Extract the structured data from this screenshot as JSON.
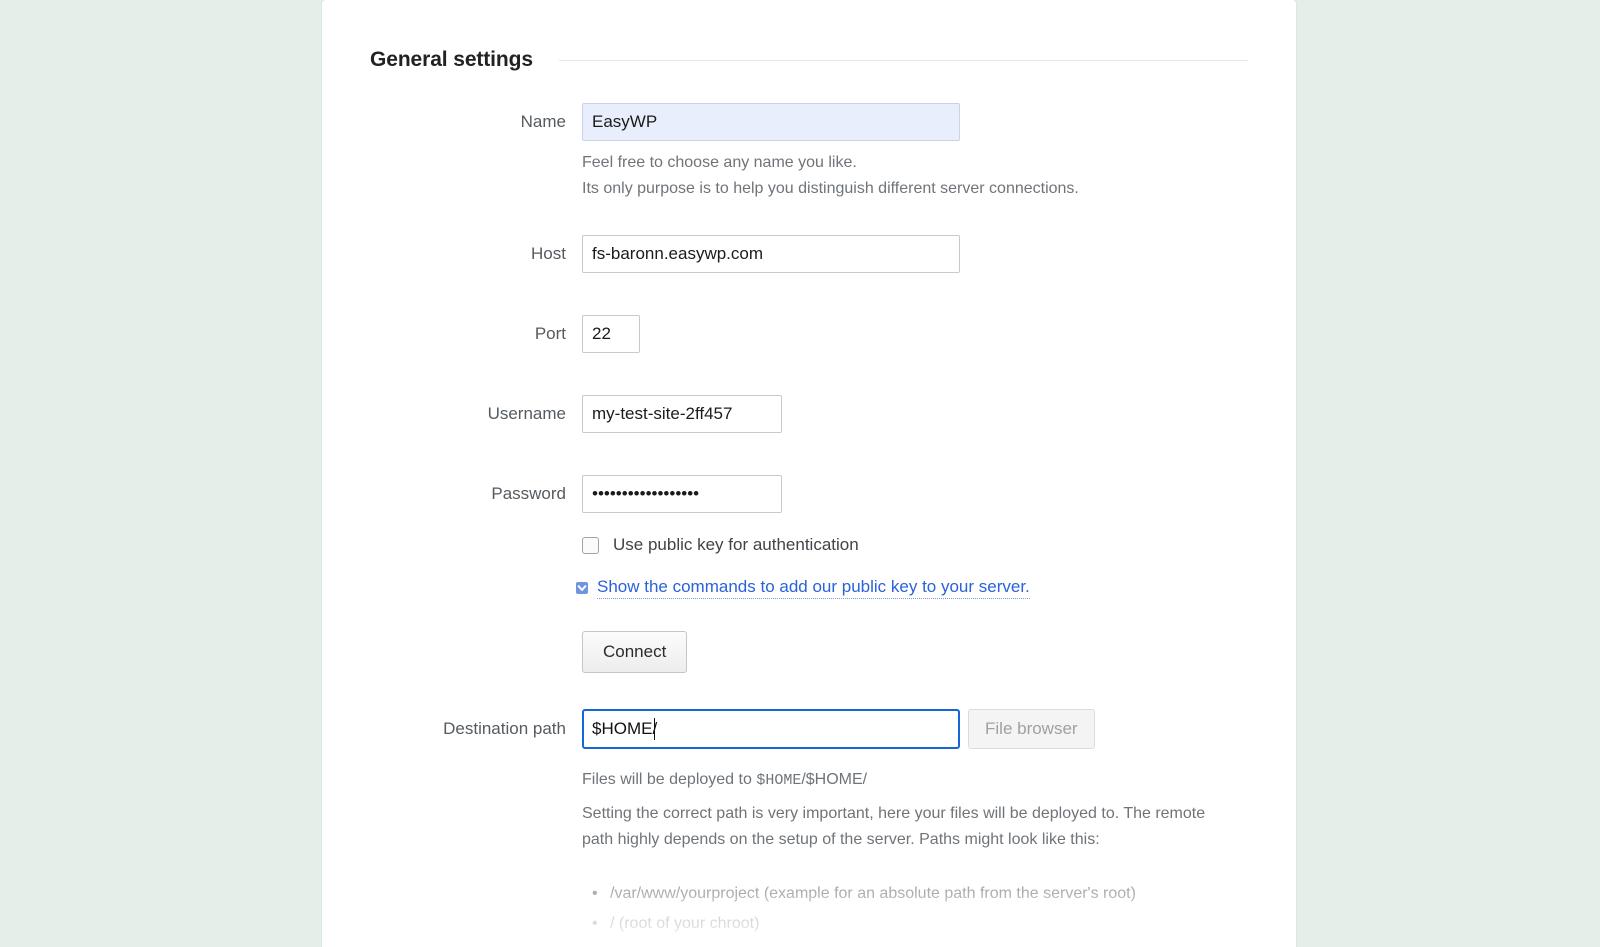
{
  "theme": {
    "page_background": "#e5efe9",
    "card_background": "#ffffff",
    "link_color": "#2a62d8",
    "focus_border": "#1566d6",
    "autofill_background": "#e8eefb",
    "label_color": "#555b60",
    "helper_color": "#6f7479"
  },
  "section": {
    "title": "General settings"
  },
  "fields": {
    "name": {
      "label": "Name",
      "value": "EasyWP",
      "placeholder": "",
      "help_line_1": "Feel free to choose any name you like.",
      "help_line_2": "Its only purpose is to help you distinguish different server connections."
    },
    "host": {
      "label": "Host",
      "value": "fs-baronn.easywp.com",
      "placeholder": ""
    },
    "port": {
      "label": "Port",
      "value": "22",
      "placeholder": ""
    },
    "username": {
      "label": "Username",
      "value": "my-test-site-2ff457",
      "placeholder": ""
    },
    "password": {
      "label": "Password",
      "value": "••••••••••••••••••",
      "placeholder": ""
    },
    "destination_path": {
      "label": "Destination path",
      "value": "$HOME/",
      "placeholder": "",
      "deployed_prefix": "Files will be deployed to ",
      "deployed_mono": "$HOME",
      "deployed_suffix": "/$HOME/",
      "description": "Setting the correct path is very important, here your files will be deployed to. The remote path highly depends on the setup of the server. Paths might look like this:",
      "examples": [
        "/var/www/yourproject (example for an absolute path from the server's root)",
        "/ (root of your chroot)"
      ]
    }
  },
  "checkboxes": {
    "use_public_key": {
      "label": "Use public key for authentication",
      "checked": false
    },
    "show_commands": {
      "label": "Show the commands to add our public key to your server.",
      "checked": true
    }
  },
  "buttons": {
    "connect": "Connect",
    "file_browser": "File browser"
  }
}
